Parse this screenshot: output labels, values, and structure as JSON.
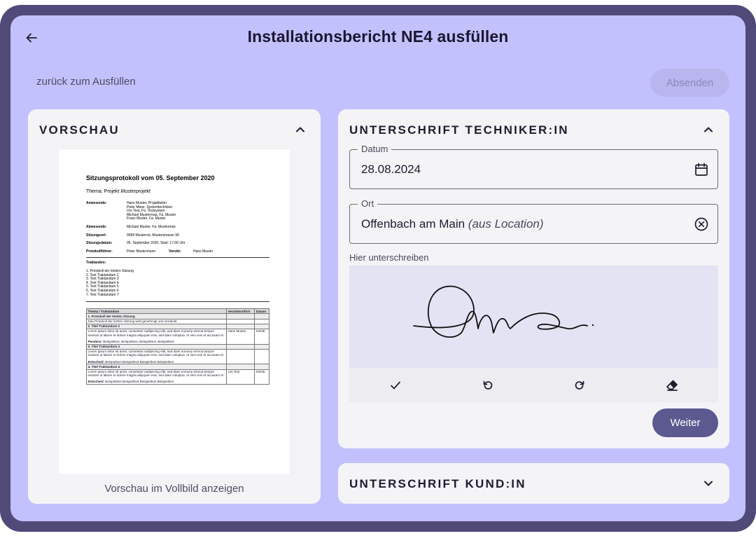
{
  "header": {
    "title": "Installationsbericht NE4 ausfüllen",
    "back_icon": "arrow-left-icon"
  },
  "toolbar": {
    "back_link": "zurück zum Ausfüllen",
    "send_label": "Absenden"
  },
  "preview": {
    "title": "VORSCHAU",
    "fullscreen_link": "Vorschau im Vollbild anzeigen",
    "document": {
      "heading": "Sitzungsprotokoll vom 05. September 2020",
      "theme_label": "Thema: Projekt ",
      "theme_value": "Musterprojekt",
      "attendees_label": "Anwesende:",
      "attendees": [
        "Hans Muster, Projektleiter",
        "Peter Meier, Systemtechniker",
        "Urs Test, Fa. Testsystem",
        "Michael Mustermaa, Fa. Muster",
        "Franz Muster, Fa. Muster"
      ],
      "absent_label": "Abwesende:",
      "absent": "Michael Muster, Fa. Mustermax",
      "location_label": "Sitzungsort:",
      "location": "9999 Musterort, Musterstrasse 99",
      "date_label": "Sitzungsdatum:",
      "date": "05. September 2020, Start: 17:00 Uhr",
      "minutes_label": "Protokollführer:",
      "minutes": "Peter Mustermann",
      "chair_label": "Vorsitz:",
      "chair": "Hans Muster",
      "agenda_label": "Traktanden:",
      "agenda": [
        "1.    Protokoll der letzten Sitzung",
        "2.    Text Traktandum 2",
        "3.    Text Traktandum 3",
        "4.    Text Traktandum 4",
        "5.    Text Traktandum 5",
        "6.    Text Traktandum 6",
        "7.    Text Traktandum 7"
      ],
      "table_headers": [
        "Thema / Traktandum",
        "Verantwortlich",
        "Datum"
      ],
      "sec1_title": "1. Protokoll der letzten Sitzung",
      "sec1_text": "Das Protokoll der letzten Sitzung wird genehmigt und verdankt.",
      "sec2_title": "2. Titel Traktandum 2",
      "sec2_text": "Lorem ipsum dolor sit amet, consetetur sadipscing elitr, sed diam nonumy eirmod tempor invidunt ut labore et dolore magna aliquyam erat, sed diam voluptua. At vero eos et accusam et",
      "sec2_resp": "Hans Muster",
      "sec2_date": "KW38",
      "sec2_note_label": "Pendenz:",
      "sec2_note": " Beispieltext, Beispieltext, Beispieltext, Beispieltext",
      "sec3_title": "3. Titel Traktandum 3",
      "sec3_text": "Lorem ipsum dolor sit amet, consetetur sadipscing elitr, sed diam nonumy eirmod tempor invidunt ut labore et dolore magna aliquyam erat, sed diam voluptua. At vero eos et accusam et",
      "sec3_note_label": "Entscheid:",
      "sec3_note": " Beispieltext Beispieltext Beispieltext Beispieltext",
      "sec4_title": "4. Titel Traktandum 4",
      "sec4_text": "Lorem ipsum dolor sit amet, consetetur sadipscing elitr, sed diam nonumy eirmod tempor invidunt ut labore et dolore magna aliquyam erat, sed diam voluptua. At vero eos et accusam et",
      "sec4_resp": "Urs Test",
      "sec4_date": "KW45",
      "sec4_note_label": "Entscheid:",
      "sec4_note": " Beispieltext Beispieltext Beispieltext Beispieltext"
    }
  },
  "technician": {
    "title": "UNTERSCHRIFT TECHNIKER:IN",
    "date_label": "Datum",
    "date_value": "28.08.2024",
    "place_label": "Ort",
    "place_value": "Offenbach am Main",
    "place_suffix": "(aus Location)",
    "sign_hint": "Hier unterschreiben",
    "next_label": "Weiter",
    "tools": [
      "check-icon",
      "undo-icon",
      "redo-icon",
      "eraser-icon"
    ]
  },
  "customer": {
    "title": "UNTERSCHRIFT KUND:IN"
  },
  "colors": {
    "frame": "#4f4a78",
    "background": "#c3c1fd",
    "card": "#f4f4f7",
    "primary_button": "#5c5990",
    "disabled_button": "#b8b5ef"
  }
}
